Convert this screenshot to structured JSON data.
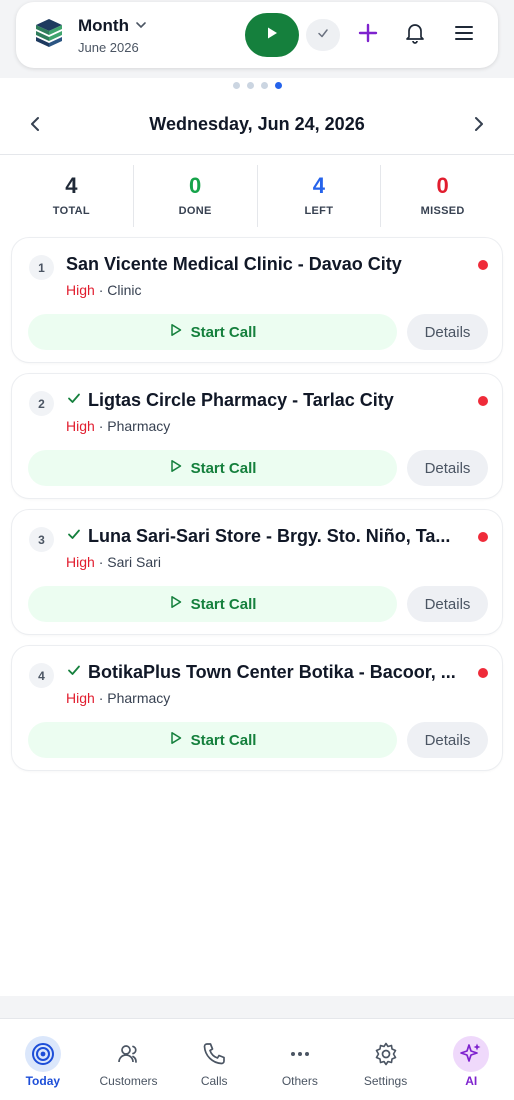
{
  "header": {
    "title": "Month",
    "subtitle": "June 2026",
    "icons": [
      "logo-icon",
      "chevron-down-icon",
      "play-icon",
      "check-icon",
      "plus-icon",
      "bell-icon",
      "menu-icon"
    ]
  },
  "pager": {
    "count": 4,
    "active": 4
  },
  "date_nav": {
    "date": "Wednesday, Jun 24, 2026"
  },
  "stats": [
    {
      "value": "4",
      "label": "TOTAL",
      "color": "#1f2937"
    },
    {
      "value": "0",
      "label": "DONE",
      "color": "#16a34a"
    },
    {
      "value": "4",
      "label": "LEFT",
      "color": "#2563eb"
    },
    {
      "value": "0",
      "label": "MISSED",
      "color": "#e11d2e"
    }
  ],
  "cards": [
    {
      "index": "1",
      "name": "San Vicente Medical Clinic - Davao City",
      "checked": false,
      "priority": "High",
      "sep": "·",
      "type": "Clinic",
      "start_label": "Start Call",
      "details_label": "Details"
    },
    {
      "index": "2",
      "name": "Ligtas Circle Pharmacy - Tarlac City",
      "checked": true,
      "priority": "High",
      "sep": "·",
      "type": "Pharmacy",
      "start_label": "Start Call",
      "details_label": "Details"
    },
    {
      "index": "3",
      "name": "Luna Sari-Sari Store - Brgy. Sto. Niño, Ta...",
      "checked": true,
      "priority": "High",
      "sep": "·",
      "type": "Sari Sari",
      "start_label": "Start Call",
      "details_label": "Details"
    },
    {
      "index": "4",
      "name": "BotikaPlus Town Center Botika - Bacoor, ...",
      "checked": true,
      "priority": "High",
      "sep": "·",
      "type": "Pharmacy",
      "start_label": "Start Call",
      "details_label": "Details"
    }
  ],
  "tabbar": {
    "items": [
      {
        "label": "Today",
        "icon": "target-icon"
      },
      {
        "label": "Customers",
        "icon": "users-icon"
      },
      {
        "label": "Calls",
        "icon": "phone-icon"
      },
      {
        "label": "Others",
        "icon": "more-icon"
      },
      {
        "label": "Settings",
        "icon": "gear-icon"
      },
      {
        "label": "AI",
        "icon": "sparkles-icon"
      }
    ]
  },
  "colors": {
    "accent_green": "#15803d",
    "accent_blue": "#2563eb",
    "accent_purple": "#7e22ce",
    "alert_red": "#e11d2e"
  }
}
